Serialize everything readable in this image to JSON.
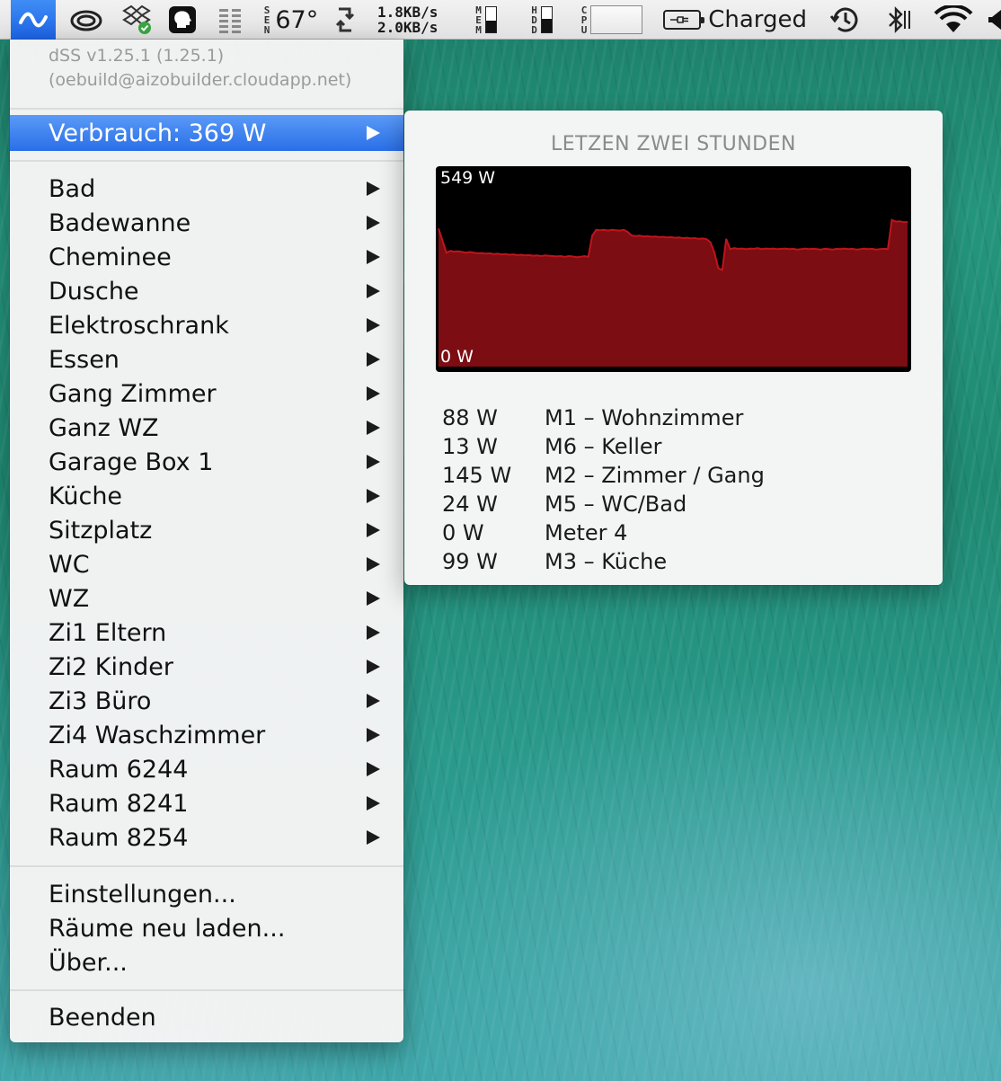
{
  "menubar": {
    "temperature": "67°",
    "sensor_label": [
      "S",
      "E",
      "N"
    ],
    "net_up": "1.8KB/s",
    "net_down": "2.0KB/s",
    "mem_label": [
      "M",
      "E",
      "M"
    ],
    "mem_usage_fraction": 0.45,
    "hdd_label": [
      "H",
      "D",
      "D"
    ],
    "hdd_usage_fraction": 0.55,
    "cpu_label": [
      "C",
      "P",
      "U"
    ],
    "battery_status": "Charged",
    "icons": [
      "dss-wave-icon",
      "creative-cloud-icon",
      "dropbox-icon",
      "head-profile-icon",
      "equalizer-icon",
      "temperature-icon",
      "sync-icon",
      "memory-icon",
      "disk-icon",
      "cpu-icon",
      "battery-icon",
      "time-machine-icon",
      "bluetooth-icon",
      "wifi-icon"
    ]
  },
  "menu": {
    "header_version": "dSS v1.25.1 (1.25.1)",
    "header_build": "(oebuild@aizobuilder.cloudapp.net)",
    "consumption_label": "Verbrauch: 369 W",
    "rooms": [
      "Bad",
      "Badewanne",
      "Cheminee",
      "Dusche",
      "Elektroschrank",
      "Essen",
      "Gang Zimmer",
      "Ganz WZ",
      "Garage Box 1",
      "Küche",
      "Sitzplatz",
      "WC",
      "WZ",
      "Zi1 Eltern",
      "Zi2 Kinder",
      "Zi3 Büro",
      "Zi4 Waschzimmer",
      "Raum 6244",
      "Raum 8241",
      "Raum 8254"
    ],
    "settings": "Einstellungen...",
    "reload_rooms": "Räume neu laden...",
    "about": "Über...",
    "quit": "Beenden"
  },
  "panel": {
    "title": "LETZEN ZWEI STUNDEN",
    "meters": [
      {
        "value": "88 W",
        "name": "M1 – Wohnzimmer"
      },
      {
        "value": "13 W",
        "name": "M6 – Keller"
      },
      {
        "value": "145 W",
        "name": "M2 – Zimmer / Gang"
      },
      {
        "value": "24 W",
        "name": "M5 – WC/Bad"
      },
      {
        "value": "0 W",
        "name": "Meter 4"
      },
      {
        "value": "99 W",
        "name": "M3 – Küche"
      }
    ]
  },
  "chart_data": {
    "type": "area",
    "title": "LETZEN ZWEI STUNDEN",
    "ymax_label": "549 W",
    "ymin_label": "0 W",
    "ylim": [
      0,
      549
    ],
    "fill_color": "#7c0d12",
    "line_color": "#c0141c",
    "background": "#000000",
    "x": [
      0,
      1,
      2,
      3,
      4,
      5,
      6,
      7,
      8,
      9,
      10,
      11,
      12,
      13,
      14,
      15,
      16,
      17,
      18,
      19,
      20,
      21,
      22,
      23,
      24,
      25,
      26,
      27,
      28,
      29,
      30,
      31,
      32,
      33,
      34,
      35,
      36,
      37,
      38,
      39,
      40,
      41,
      42,
      43,
      44,
      45,
      46,
      47,
      48,
      49,
      50,
      51,
      52,
      53,
      54,
      55,
      56,
      57,
      58,
      59,
      60,
      61,
      62,
      63,
      64,
      65,
      66,
      67,
      68,
      69,
      70,
      71,
      72,
      73,
      74,
      75,
      76,
      77,
      78,
      79,
      80,
      81,
      82,
      83,
      84,
      85,
      86,
      87,
      88,
      89,
      90,
      91,
      92,
      93,
      94,
      95,
      96,
      97,
      98,
      99,
      100,
      101,
      102,
      103,
      104,
      105,
      106,
      107,
      108,
      109,
      110,
      111,
      112,
      113,
      114,
      115,
      116,
      117,
      118,
      119
    ],
    "values": [
      400,
      365,
      330,
      335,
      333,
      334,
      332,
      330,
      332,
      330,
      328,
      329,
      327,
      328,
      326,
      327,
      325,
      326,
      324,
      325,
      323,
      324,
      322,
      323,
      321,
      322,
      320,
      322,
      321,
      320,
      319,
      320,
      318,
      320,
      319,
      317,
      318,
      320,
      318,
      379,
      396,
      395,
      396,
      394,
      396,
      395,
      394,
      396,
      390,
      380,
      378,
      379,
      377,
      378,
      376,
      377,
      375,
      376,
      374,
      375,
      373,
      374,
      372,
      373,
      371,
      372,
      370,
      371,
      369,
      360,
      330,
      285,
      280,
      370,
      340,
      343,
      341,
      342,
      340,
      342,
      341,
      343,
      340,
      342,
      341,
      342,
      340,
      341,
      342,
      340,
      341,
      339,
      340,
      342,
      340,
      341,
      340,
      339,
      341,
      340,
      339,
      341,
      340,
      342,
      340,
      341,
      339,
      340,
      342,
      340,
      341,
      339,
      340,
      341,
      340,
      425,
      420,
      421,
      418,
      419
    ]
  },
  "colors": {
    "accent": "#2a6fe8",
    "chart_fill": "#7c0d12"
  }
}
